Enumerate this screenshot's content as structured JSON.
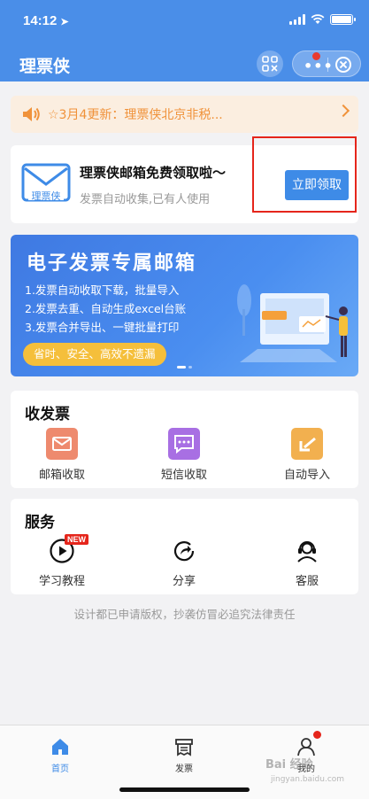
{
  "status": {
    "time": "14:12"
  },
  "header": {
    "title": "理票侠"
  },
  "notice": {
    "text": "☆3月4更新：理票侠北京非税..."
  },
  "mail_card": {
    "icon_label": "理票侠",
    "title": "理票侠邮箱免费领取啦～",
    "subtitle": "发票自动收集,已有人使用",
    "button": "立即领取"
  },
  "banner": {
    "title": "电子发票专属邮箱",
    "lines": [
      "1.发票自动收取下载，批量导入",
      "2.发票去重、自动生成excel台账",
      "3.发票合并导出、一键批量打印"
    ],
    "pill": "省时、安全、高效不遗漏"
  },
  "receive": {
    "title": "收发票",
    "items": [
      {
        "label": "邮箱收取",
        "color": "#ee8a6e"
      },
      {
        "label": "短信收取",
        "color": "#a86fe3"
      },
      {
        "label": "自动导入",
        "color": "#f2b04f"
      }
    ]
  },
  "service": {
    "title": "服务",
    "badge": "NEW",
    "items": [
      {
        "label": "学习教程"
      },
      {
        "label": "分享"
      },
      {
        "label": "客服"
      }
    ]
  },
  "copyright": "设计都已申请版权，抄袭仿冒必追究法律责任",
  "tabbar": {
    "items": [
      {
        "label": "首页",
        "active": true
      },
      {
        "label": "发票",
        "active": false
      },
      {
        "label": "我的",
        "active": false
      }
    ]
  },
  "watermark": {
    "main": "Bai 经验",
    "sub": "jingyan.baidu.com"
  },
  "colors": {
    "primary": "#4a8ee8",
    "accent_red": "#e5251b",
    "notice": "#f0923a"
  }
}
